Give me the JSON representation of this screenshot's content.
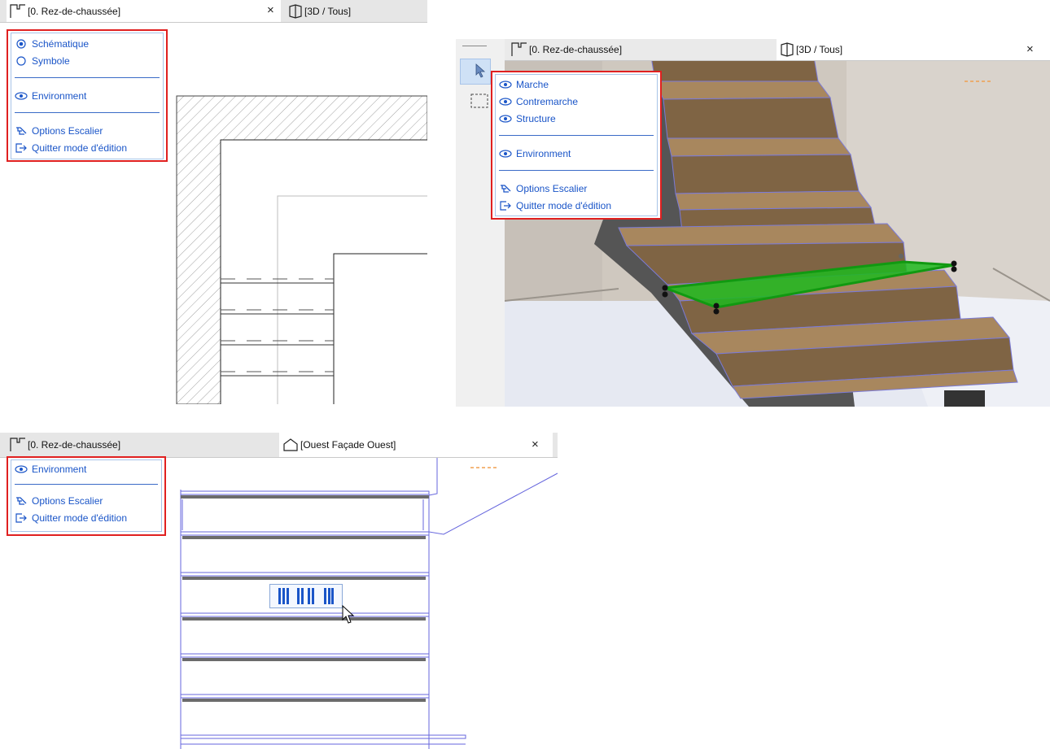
{
  "panel_top_left": {
    "tabs": [
      {
        "label": "[0. Rez-de-chaussée]",
        "active": true
      },
      {
        "label": "[3D / Tous]",
        "active": false
      }
    ],
    "close_symbol": "×",
    "menu": {
      "radio_items": [
        {
          "label": "Schématique",
          "selected": true
        },
        {
          "label": "Symbole",
          "selected": false
        }
      ],
      "environment_label": "Environment",
      "options_label": "Options Escalier",
      "exit_label": "Quitter mode d'édition"
    }
  },
  "panel_top_right": {
    "tabs": [
      {
        "label": "[0. Rez-de-chaussée]",
        "active": false
      },
      {
        "label": "[3D / Tous]",
        "active": true
      }
    ],
    "close_symbol": "×",
    "toolbox": [
      "arrow-tool-icon",
      "marquee-tool-icon"
    ],
    "menu": {
      "visibility_items": [
        "Marche",
        "Contremarche",
        "Structure"
      ],
      "environment_label": "Environment",
      "options_label": "Options Escalier",
      "exit_label": "Quitter mode d'édition"
    },
    "colors": {
      "wall": "#cfc8c0",
      "tread": "#a8875e",
      "riser": "#7f6444",
      "highlight": "#1fb81f",
      "stringer": "#4d4d4d"
    }
  },
  "panel_bottom": {
    "tabs": [
      {
        "label": "[0. Rez-de-chaussée]",
        "active": false
      },
      {
        "label": "[Ouest Façade Ouest]",
        "active": true
      }
    ],
    "close_symbol": "×",
    "menu": {
      "environment_label": "Environment",
      "options_label": "Options Escalier",
      "exit_label": "Quitter mode d'édition"
    }
  }
}
